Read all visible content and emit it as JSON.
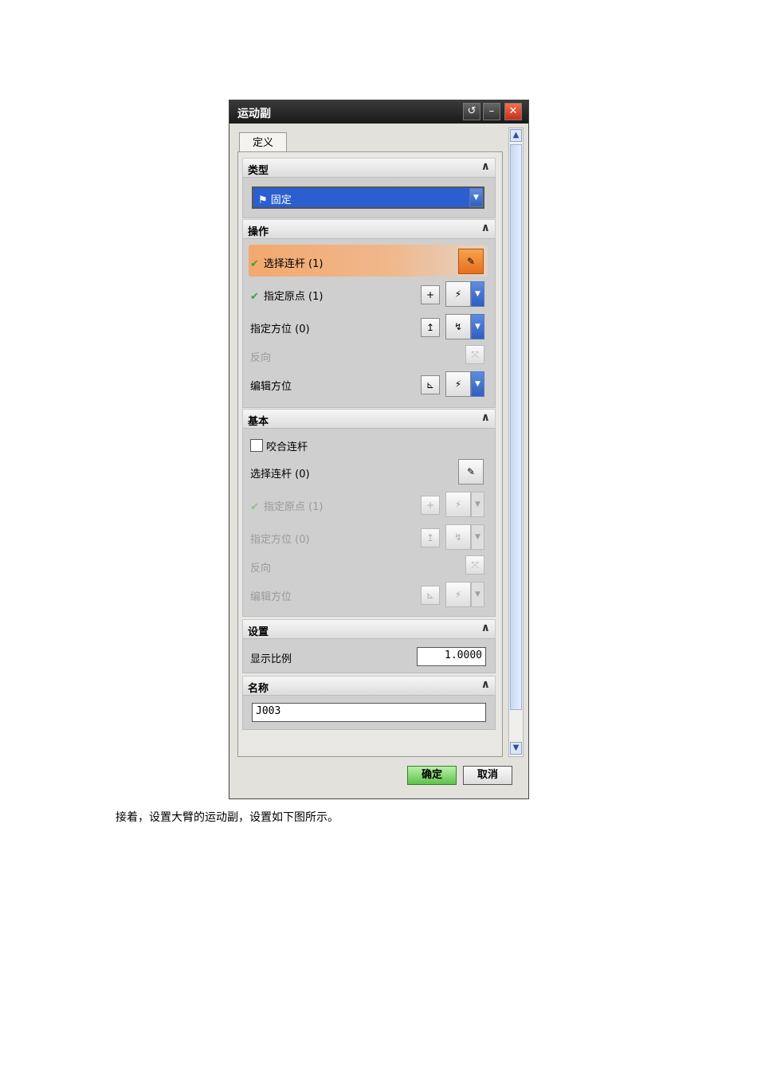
{
  "dialog": {
    "title": "运动副",
    "tab": "定义",
    "sections": {
      "type": {
        "header": "类型",
        "selected": "固定"
      },
      "operation": {
        "header": "操作",
        "select_link": "选择连杆 (1)",
        "specify_origin": "指定原点 (1)",
        "specify_orientation": "指定方位 (0)",
        "reverse": "反向",
        "edit_orientation": "编辑方位"
      },
      "base": {
        "header": "基本",
        "mesh_link": "咬合连杆",
        "select_link": "选择连杆 (0)",
        "specify_origin": "指定原点 (1)",
        "specify_orientation": "指定方位 (0)",
        "reverse": "反向",
        "edit_orientation": "编辑方位"
      },
      "settings": {
        "header": "设置",
        "display_scale_label": "显示比例",
        "display_scale_value": "1.0000"
      },
      "name": {
        "header": "名称",
        "value": "J003"
      }
    },
    "buttons": {
      "ok": "确定",
      "cancel": "取消"
    }
  },
  "caption": "接着，设置大臂的运动副，设置如下图所示。"
}
